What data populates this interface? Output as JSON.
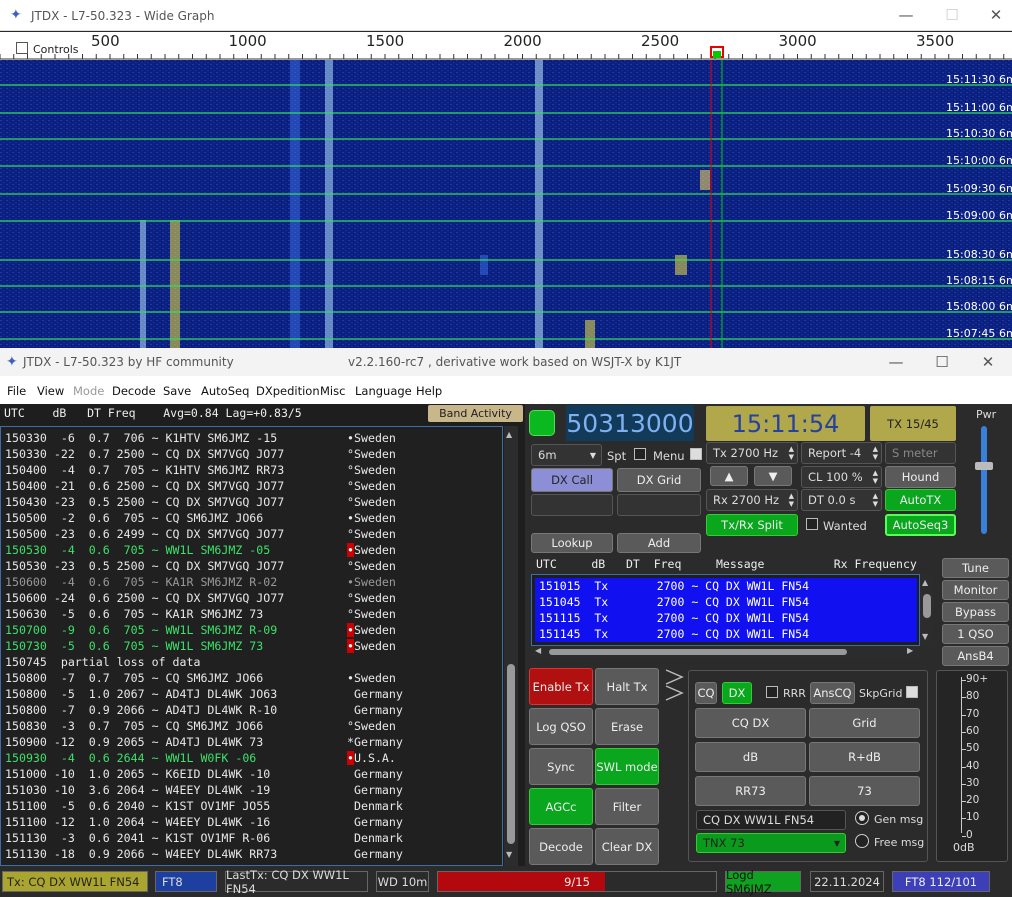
{
  "wide": {
    "title": "JTDX - L7-50.323 - Wide Graph",
    "controls": "Controls",
    "ticks": [
      "500",
      "1000",
      "1500",
      "2000",
      "2500",
      "3000",
      "3500"
    ],
    "times": [
      "15:11:30",
      "15:11:00",
      "15:10:30",
      "15:10:00",
      "15:09:30",
      "15:09:00",
      "15:08:30",
      "15:08:15",
      "15:08:00",
      "15:07:45"
    ],
    "band": "6m"
  },
  "main": {
    "title": "JTDX - L7-50.323  by HF community",
    "subtitle": "v2.2.160-rc7 , derivative work based on WSJT-X by K1JT",
    "menu": [
      "File",
      "View",
      "Mode",
      "Decode",
      "Save",
      "AutoSeq",
      "DXpedition",
      "Misc",
      "Language",
      "Help"
    ]
  },
  "band": {
    "header": "UTC    dB   DT Freq    Avg=0.84 Lag=+0.83/5",
    "activity_label": "Band Activity",
    "rows": [
      {
        "t": "150330  -6  0.7  706 ~ K1HTV SM6JMZ -15          •Sweden",
        "c": "#e8e8e8",
        "m": false
      },
      {
        "t": "150330 -22  0.7 2500 ~ CQ DX SM7VGQ JO77         °Sweden",
        "c": "#e8e8e8",
        "m": false
      },
      {
        "t": "150400  -4  0.7  705 ~ K1HTV SM6JMZ RR73         °Sweden",
        "c": "#e8e8e8",
        "m": false
      },
      {
        "t": "150400 -21  0.6 2500 ~ CQ DX SM7VGQ JO77         °Sweden",
        "c": "#e8e8e8",
        "m": false
      },
      {
        "t": "150430 -23  0.5 2500 ~ CQ DX SM7VGQ JO77         °Sweden",
        "c": "#e8e8e8",
        "m": false
      },
      {
        "t": "150500  -2  0.6  705 ~ CQ SM6JMZ JO66            •Sweden",
        "c": "#e8e8e8",
        "m": false
      },
      {
        "t": "150500 -23  0.6 2499 ~ CQ DX SM7VGQ JO77         °Sweden",
        "c": "#e8e8e8",
        "m": false
      },
      {
        "t": "150530  -4  0.6  705 ~ WW1L SM6JMZ -05           ",
        "c": "#3de06a",
        "m": true,
        "s": "Sweden"
      },
      {
        "t": "150530 -23  0.5 2500 ~ CQ DX SM7VGQ JO77         °Sweden",
        "c": "#e8e8e8",
        "m": false
      },
      {
        "t": "150600  -4  0.6  705 ~ KA1R SM6JMZ R-02          •Sweden",
        "c": "#999",
        "m": false
      },
      {
        "t": "150600 -24  0.6 2500 ~ CQ DX SM7VGQ JO77         °Sweden",
        "c": "#e8e8e8",
        "m": false
      },
      {
        "t": "150630  -5  0.6  705 ~ KA1R SM6JMZ 73            °Sweden",
        "c": "#e8e8e8",
        "m": false
      },
      {
        "t": "150700  -9  0.6  705 ~ WW1L SM6JMZ R-09          ",
        "c": "#3de06a",
        "m": true,
        "s": "Sweden"
      },
      {
        "t": "150730  -5  0.6  705 ~ WW1L SM6JMZ 73            ",
        "c": "#3de06a",
        "m": true,
        "s": "Sweden"
      },
      {
        "t": "150745  partial loss of data",
        "c": "#e8e8e8",
        "m": false
      },
      {
        "t": "150800  -7  0.7  705 ~ CQ SM6JMZ JO66            •Sweden",
        "c": "#e8e8e8",
        "m": false
      },
      {
        "t": "150800  -5  1.0 2067 ~ AD4TJ DL4WK JO63           Germany",
        "c": "#e8e8e8",
        "m": false
      },
      {
        "t": "150800  -7  0.9 2066 ~ AD4TJ DL4WK R-10           Germany",
        "c": "#e8e8e8",
        "m": false
      },
      {
        "t": "150830  -3  0.7  705 ~ CQ SM6JMZ JO66            °Sweden",
        "c": "#e8e8e8",
        "m": false
      },
      {
        "t": "150900 -12  0.9 2065 ~ AD4TJ DL4WK 73            *Germany",
        "c": "#e8e8e8",
        "m": false
      },
      {
        "t": "150930  -4  0.6 2644 ~ WW1L W0FK -06             ",
        "c": "#3de06a",
        "m": true,
        "s": "U.S.A."
      },
      {
        "t": "151000 -10  1.0 2065 ~ K6EID DL4WK -10            Germany",
        "c": "#e8e8e8",
        "m": false
      },
      {
        "t": "151030 -10  3.6 2064 ~ W4EEY DL4WK -19            Germany",
        "c": "#e8e8e8",
        "m": false
      },
      {
        "t": "151100  -5  0.6 2040 ~ K1ST OV1MF JO55            Denmark",
        "c": "#e8e8e8",
        "m": false
      },
      {
        "t": "151100 -12  1.0 2064 ~ W4EEY DL4WK -16            Germany",
        "c": "#e8e8e8",
        "m": false
      },
      {
        "t": "151130  -3  0.6 2041 ~ K1ST OV1MF R-06            Denmark",
        "c": "#e8e8e8",
        "m": false
      },
      {
        "t": "151130 -18  0.9 2066 ~ W4EEY DL4WK RR73           Germany",
        "c": "#e8e8e8",
        "m": false
      }
    ]
  },
  "ctrl": {
    "freq": "50313000",
    "time": "15:11:54",
    "tx_period": "TX 15/45",
    "pwr": "Pwr",
    "band": "6m",
    "spt": "Spt",
    "menu": "Menu",
    "dx_call": "DX Call",
    "dx_grid": "DX Grid",
    "tx_hz": "Tx  2700  Hz",
    "rx_hz": "Rx  2700  Hz",
    "report": "Report -4",
    "smeter": "S meter",
    "cl": "CL  100 %",
    "hound": "Hound",
    "dt": "DT 0.0 s",
    "autotx": "AutoTX",
    "txrx_split": "Tx/Rx Split",
    "wanted": "Wanted",
    "autoseq3": "AutoSeq3",
    "lookup": "Lookup",
    "add": "Add"
  },
  "rx": {
    "header": "UTC     dB   DT  Freq     Message          Rx Frequency",
    "rows": [
      "151015  Tx       2700 ~ CQ DX WW1L FN54",
      "151045  Tx       2700 ~ CQ DX WW1L FN54",
      "151115  Tx       2700 ~ CQ DX WW1L FN54",
      "151145  Tx       2700 ~ CQ DX WW1L FN54"
    ]
  },
  "side": {
    "tune": "Tune",
    "monitor": "Monitor",
    "bypass": "Bypass",
    "one_qso": "1 QSO",
    "ansb4": "AnsB4"
  },
  "bottom": {
    "enable_tx": "Enable Tx",
    "halt_tx": "Halt Tx",
    "log_qso": "Log QSO",
    "erase": "Erase",
    "sync": "Sync",
    "swl": "SWL mode",
    "agcc": "AGCc",
    "filter": "Filter",
    "decode": "Decode",
    "clear_dx": "Clear DX"
  },
  "txpanel": {
    "cq": "CQ",
    "dx": "DX",
    "rrr": "RRR",
    "anscq": "AnsCQ",
    "skpgrid": "SkpGrid",
    "cqdx": "CQ DX",
    "grid": "Grid",
    "db": "dB",
    "rdb": "R+dB",
    "rr73": "RR73",
    "s73": "73",
    "msg": "CQ DX WW1L FN54",
    "gen": "Gen msg",
    "tnx": "TNX 73",
    "free": "Free msg"
  },
  "meter": {
    "scale": [
      "90+",
      "80",
      "70",
      "60",
      "50",
      "40",
      "30",
      "20",
      "10",
      "0"
    ],
    "db": "0dB"
  },
  "status": {
    "tx": "Tx: CQ DX WW1L FN54",
    "mode": "FT8",
    "lasttx": "LastTx: CQ DX WW1L FN54",
    "wd": "WD 10m",
    "progress": "9/15",
    "progress_frac": 0.6,
    "logd": "Logd SM6JMZ",
    "date": "22.11.2024",
    "ft8": "FT8  112/101"
  }
}
